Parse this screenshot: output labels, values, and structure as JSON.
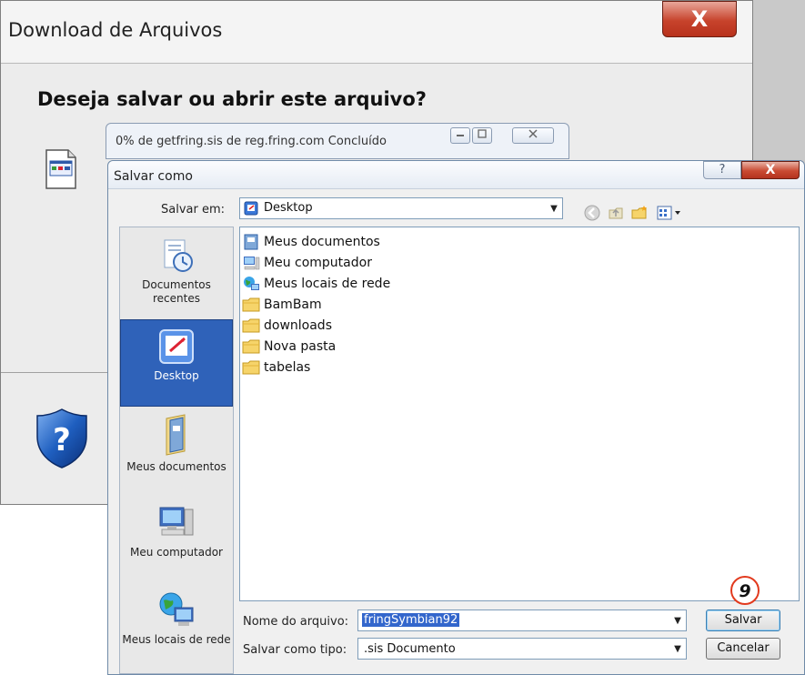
{
  "download_dialog": {
    "title": "Download de Arquivos",
    "close_label": "X",
    "heading": "Deseja salvar ou abrir este arquivo?"
  },
  "progress_window": {
    "title": "0% de getfring.sis de reg.fring.com Concluído",
    "progress_percent": 0
  },
  "save_dialog": {
    "title": "Salvar como",
    "help_label": "?",
    "close_label": "X",
    "location_label": "Salvar em:",
    "location_value": "Desktop",
    "places": [
      {
        "label": "Documentos recentes"
      },
      {
        "label": "Desktop"
      },
      {
        "label": "Meus documentos"
      },
      {
        "label": "Meu computador"
      },
      {
        "label": "Meus locais de rede"
      }
    ],
    "files": [
      {
        "name": "Meus documentos",
        "icon": "my-documents-icon"
      },
      {
        "name": "Meu computador",
        "icon": "my-computer-icon"
      },
      {
        "name": "Meus locais de rede",
        "icon": "network-places-icon"
      },
      {
        "name": "BamBam",
        "icon": "folder-icon"
      },
      {
        "name": "downloads",
        "icon": "folder-icon"
      },
      {
        "name": "Nova pasta",
        "icon": "folder-icon"
      },
      {
        "name": "tabelas",
        "icon": "folder-icon"
      }
    ],
    "filename_label": "Nome do arquivo:",
    "filename_value": "fringSymbian92",
    "filetype_label": "Salvar como tipo:",
    "filetype_value": ".sis Documento",
    "save_button": "Salvar",
    "cancel_button": "Cancelar"
  },
  "annotation": {
    "step_number": "9",
    "color": "#e23a1e"
  }
}
